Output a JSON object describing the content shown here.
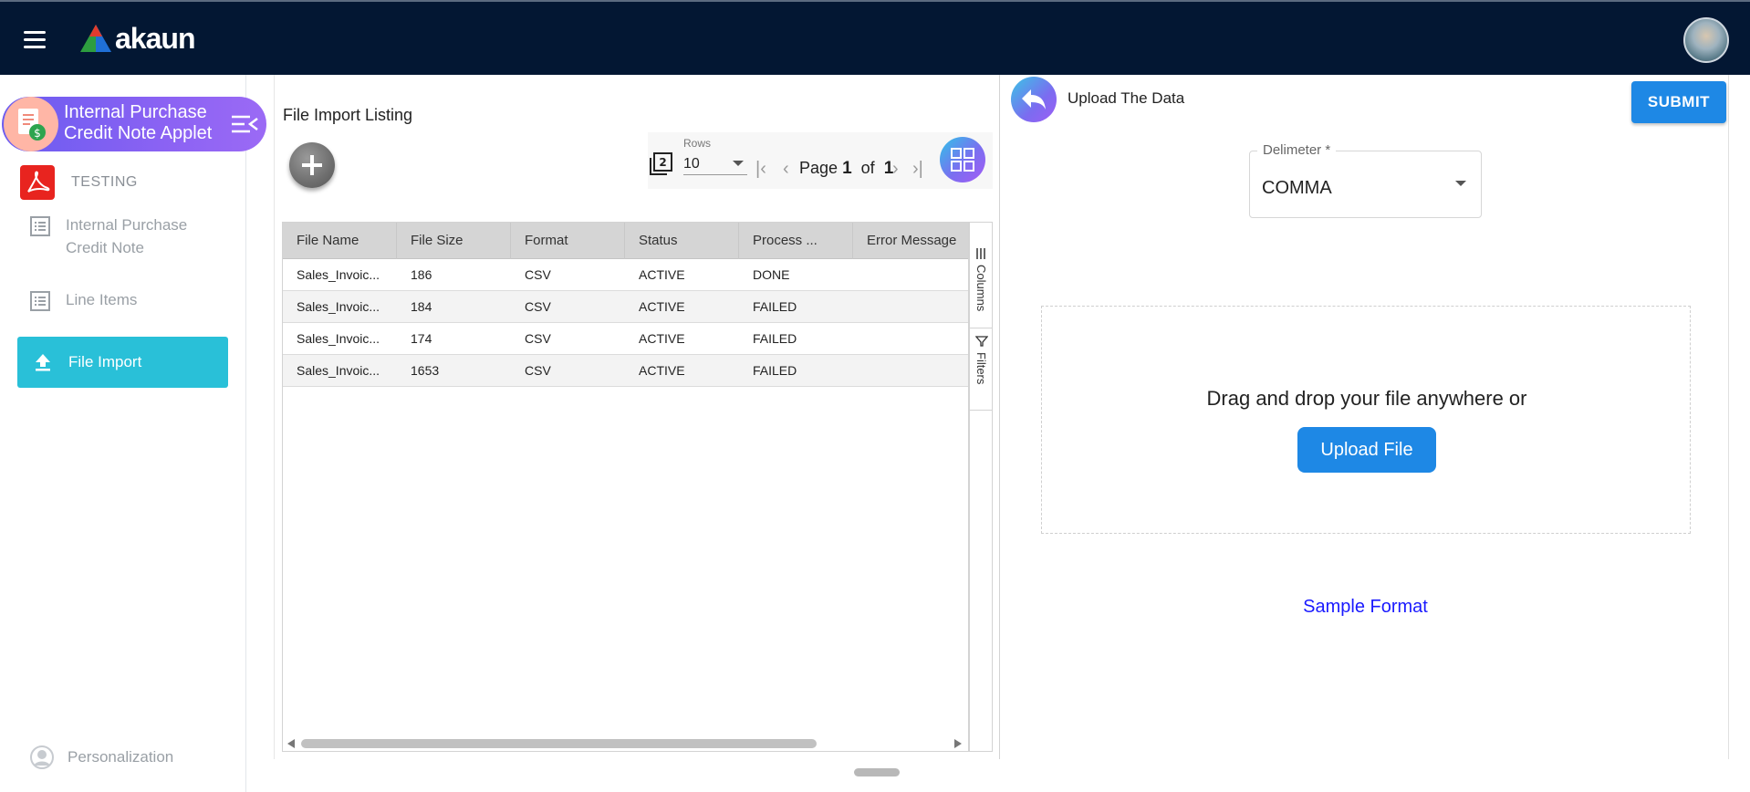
{
  "header": {
    "logo_text": "akaun",
    "icons": [
      "menu-icon",
      "akaun-logo",
      "user-avatar"
    ]
  },
  "sidebar": {
    "app_title": "Internal Purchase Credit Note Applet",
    "group_label": "TESTING",
    "items": [
      {
        "label": "Internal Purchase Credit Note",
        "icon": "list-icon"
      },
      {
        "label": "Line Items",
        "icon": "list-icon"
      },
      {
        "label": "File Import",
        "icon": "upload-icon",
        "active": true
      }
    ],
    "personalization_label": "Personalization",
    "accent_color": "#29c0d8"
  },
  "listing": {
    "title": "File Import Listing",
    "rows_label": "Rows",
    "rows_value": "10",
    "page_label": "Page",
    "page_current": "1",
    "page_of": "of",
    "page_total": "1",
    "columns": [
      "File Name",
      "File Size",
      "Format",
      "Status",
      "Process ...",
      "Error Message"
    ],
    "rows": [
      [
        "Sales_Invoic...",
        "186",
        "CSV",
        "ACTIVE",
        "DONE",
        ""
      ],
      [
        "Sales_Invoic...",
        "184",
        "CSV",
        "ACTIVE",
        "FAILED",
        ""
      ],
      [
        "Sales_Invoic...",
        "174",
        "CSV",
        "ACTIVE",
        "FAILED",
        ""
      ],
      [
        "Sales_Invoic...",
        "1653",
        "CSV",
        "ACTIVE",
        "FAILED",
        ""
      ]
    ],
    "side_tabs": [
      "Columns",
      "Filters"
    ]
  },
  "upload": {
    "title": "Upload The Data",
    "submit_label": "SUBMIT",
    "delimiter_label": "Delimeter *",
    "delimiter_value": "COMMA",
    "drop_text": "Drag and drop your file anywhere or",
    "upload_button": "Upload File",
    "sample_link": "Sample Format",
    "button_color": "#1e88e5"
  }
}
